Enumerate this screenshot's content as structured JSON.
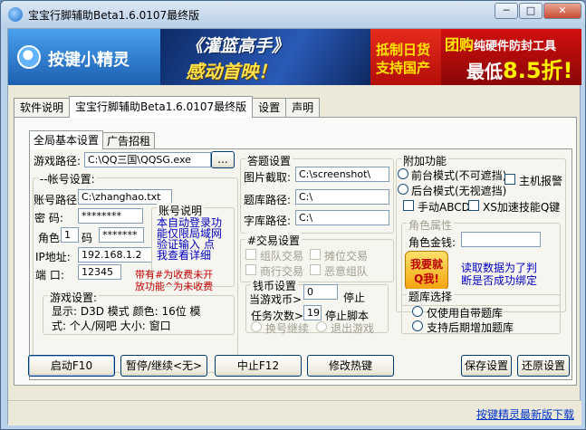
{
  "window": {
    "title": "宝宝行脚辅助Beta1.6.0107最终版",
    "minimize": "─",
    "maximize": "□",
    "close": "✕"
  },
  "banner": {
    "logo": "按键小精灵",
    "ad1_title": "《灌篮高手》",
    "ad1_sub": "感动首映！",
    "ad2_line1": "抵制日货",
    "ad2_line2": "支持国产",
    "ad3_prefix": "团购",
    "ad3_line1": "纯硬件防封工具",
    "ad3_price_prefix": "最低",
    "ad3_price": "8.5折!"
  },
  "tabs": [
    "软件说明",
    "宝宝行脚辅助Beta1.6.0107最终版",
    "设置",
    "声明"
  ],
  "inner_tabs": [
    "全局基本设置",
    "广告招租"
  ],
  "game_path": {
    "label": "游戏路径:",
    "value": "C:\\QQ三国\\QQSG.exe",
    "browse": "..."
  },
  "account": {
    "group_title": "--帐号设置:",
    "path_label": "账号路径",
    "path_value": "C:\\zhanghao.txt",
    "password_label": "密  码:",
    "password_value": "********",
    "role_label": "角色",
    "role_value": "1",
    "code_label": "码",
    "code_value": "*******",
    "ip_label": "IP地址:",
    "ip_value": "192.168.1.2",
    "port_label": "端  口:",
    "port_value": "12345",
    "note_title": "账号说明",
    "note_lines": [
      "本自动登录功",
      "能仅限局域网",
      "验证输入 点",
      "我查看详细"
    ],
    "warning_lines": [
      "带有#为收费未开",
      "放功能^为未收费"
    ],
    "game_settings_title": "游戏设置:",
    "game_settings_line1": "显示: D3D  模式 颜色: 16位 模",
    "game_settings_line2": "式: 个人/网吧 大小: 窗口"
  },
  "answer": {
    "title": "答题设置",
    "capture_label": "图片截取:",
    "capture_value": "C:\\screenshot\\",
    "bank_label": "题库路径:",
    "bank_value": "C:\\",
    "font_label": "字库路径:",
    "font_value": "C:\\"
  },
  "trade": {
    "title": "#交易设置",
    "options": [
      "组队交易",
      "摊位交易",
      "商行交易",
      "恶意组队"
    ]
  },
  "money": {
    "title": "钱币设置",
    "current_label": "当游戏币>",
    "current_value": "0",
    "stop_label": "停止",
    "task_label": "任务次数>",
    "task_value": "19",
    "stop_script": "停止脚本",
    "switch_account": "换号继续",
    "exit_game": "退出游戏"
  },
  "extra": {
    "title": "附加功能",
    "front_mode": "前台模式(不可遮挡)",
    "back_mode": "后台模式(无视遮挡)",
    "host_alarm": "主机报警",
    "manual_abcd": "手动ABCD",
    "xs_accel": "XS加速技能Q键",
    "role_attr_title": "角色属性",
    "role_gold_label": "角色金钱:",
    "role_gold_value": "",
    "ad_badge": "我要就Q我!",
    "ad_text_line1": "读取数据为了判",
    "ad_text_line2": "断是否成功绑定"
  },
  "question_bank": {
    "title": "题库选择",
    "builtin": "仅使用自带题库",
    "late_add": "支持后期增加题库"
  },
  "buttons": {
    "start": "启动F10",
    "pause": "暂停/继续<无>",
    "stop": "中止F12",
    "hotkey": "修改热键",
    "save": "保存设置",
    "restore": "还原设置"
  },
  "status": {
    "link": "按键精灵最新版下载"
  }
}
